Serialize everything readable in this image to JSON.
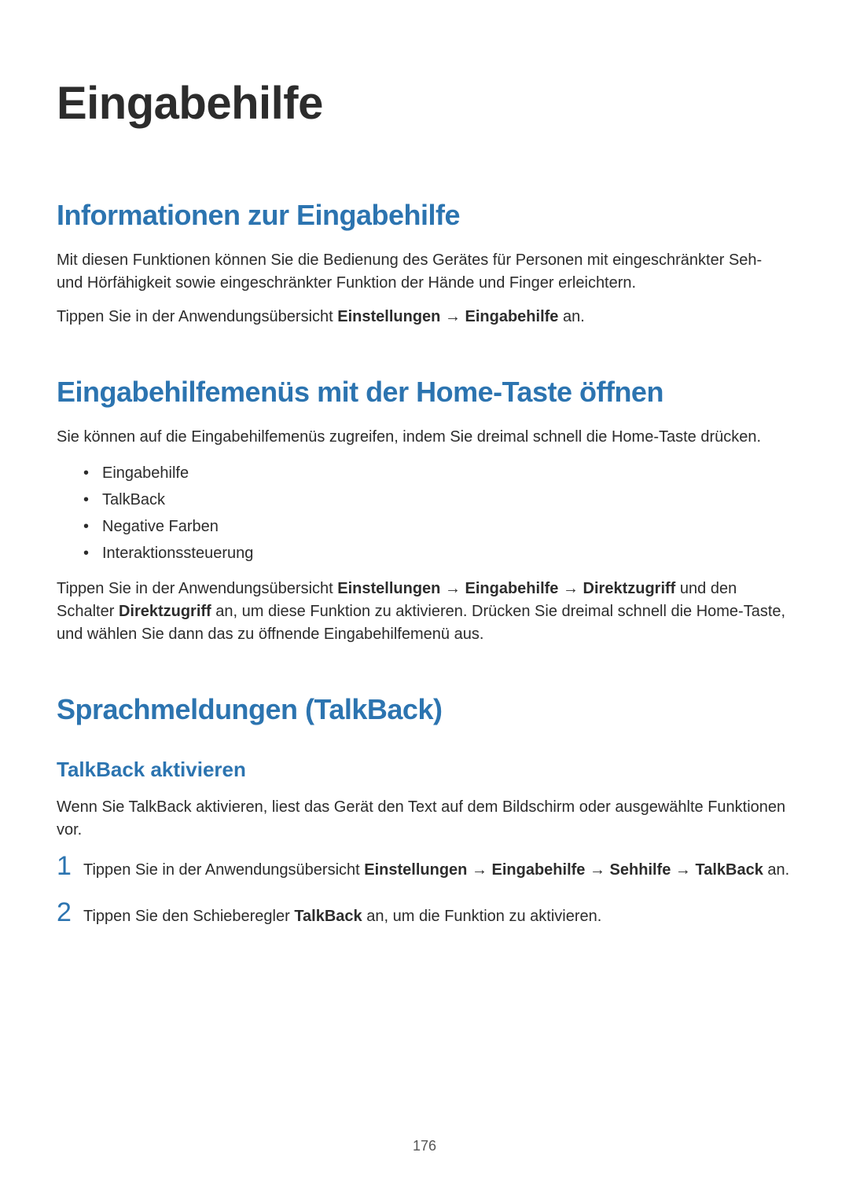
{
  "title": "Eingabehilfe",
  "section1": {
    "heading": "Informationen zur Eingabehilfe",
    "p1": "Mit diesen Funktionen können Sie die Bedienung des Gerätes für Personen mit eingeschränkter Seh- und Hörfähigkeit sowie eingeschränkter Funktion der Hände und Finger erleichtern.",
    "p2_pre": "Tippen Sie in der Anwendungsübersicht ",
    "p2_b1": "Einstellungen",
    "p2_arrow1": " → ",
    "p2_b2": "Eingabehilfe",
    "p2_post": " an."
  },
  "section2": {
    "heading": "Eingabehilfemenüs mit der Home-Taste öffnen",
    "p1": "Sie können auf die Eingabehilfemenüs zugreifen, indem Sie dreimal schnell die Home-Taste drücken.",
    "bullets": {
      "0": "Eingabehilfe",
      "1": "TalkBack",
      "2": "Negative Farben",
      "3": "Interaktionssteuerung"
    },
    "p2_pre": "Tippen Sie in der Anwendungsübersicht ",
    "p2_b1": "Einstellungen",
    "p2_a1": " → ",
    "p2_b2": "Eingabehilfe",
    "p2_a2": " → ",
    "p2_b3": "Direktzugriff",
    "p2_mid": " und den Schalter ",
    "p2_b4": "Direktzugriff",
    "p2_post": " an, um diese Funktion zu aktivieren. Drücken Sie dreimal schnell die Home-Taste, und wählen Sie dann das zu öffnende Eingabehilfemenü aus."
  },
  "section3": {
    "heading": "Sprachmeldungen (TalkBack)",
    "sub1": {
      "heading": "TalkBack aktivieren",
      "p1": "Wenn Sie TalkBack aktivieren, liest das Gerät den Text auf dem Bildschirm oder ausgewählte Funktionen vor.",
      "steps": {
        "0": {
          "num": "1",
          "pre": "Tippen Sie in der Anwendungsübersicht ",
          "b1": "Einstellungen",
          "a1": " → ",
          "b2": "Eingabehilfe",
          "a2": " → ",
          "b3": "Sehhilfe",
          "a3": " → ",
          "b4": "TalkBack",
          "post": " an."
        },
        "1": {
          "num": "2",
          "pre": "Tippen Sie den Schieberegler ",
          "b1": "TalkBack",
          "post": " an, um die Funktion zu aktivieren."
        }
      }
    }
  },
  "pageNumber": "176"
}
